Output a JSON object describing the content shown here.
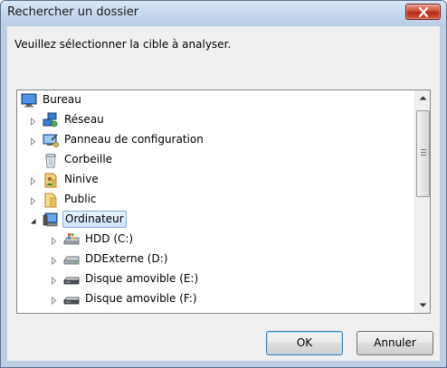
{
  "window": {
    "title": "Rechercher un dossier",
    "prompt": "Veuillez sélectionner la cible à analyser."
  },
  "tree": {
    "items": [
      {
        "label": "Bureau",
        "icon": "desktop-icon",
        "level": 0,
        "expander": "none"
      },
      {
        "label": "Réseau",
        "icon": "network-icon",
        "level": 1,
        "expander": "collapsed"
      },
      {
        "label": "Panneau de configuration",
        "icon": "control-panel-icon",
        "level": 1,
        "expander": "collapsed"
      },
      {
        "label": "Corbeille",
        "icon": "recycle-bin-icon",
        "level": 1,
        "expander": "none"
      },
      {
        "label": "Ninive",
        "icon": "user-folder-icon",
        "level": 1,
        "expander": "collapsed"
      },
      {
        "label": "Public",
        "icon": "folder-icon",
        "level": 1,
        "expander": "collapsed"
      },
      {
        "label": "Ordinateur",
        "icon": "computer-icon",
        "level": 1,
        "expander": "expanded",
        "selected": true
      },
      {
        "label": "HDD (C:)",
        "icon": "system-drive-icon",
        "level": 2,
        "expander": "collapsed"
      },
      {
        "label": "DDExterne (D:)",
        "icon": "drive-icon",
        "level": 2,
        "expander": "collapsed"
      },
      {
        "label": "Disque amovible (E:)",
        "icon": "removable-drive-icon",
        "level": 2,
        "expander": "collapsed"
      },
      {
        "label": "Disque amovible (F:)",
        "icon": "removable-drive-icon",
        "level": 2,
        "expander": "collapsed"
      }
    ]
  },
  "buttons": {
    "ok": "OK",
    "cancel": "Annuler"
  },
  "colors": {
    "frame": "#bfcfe3",
    "client": "#f0f0f0",
    "close_button": "#c8402a",
    "selection_border": "#84acdd"
  }
}
